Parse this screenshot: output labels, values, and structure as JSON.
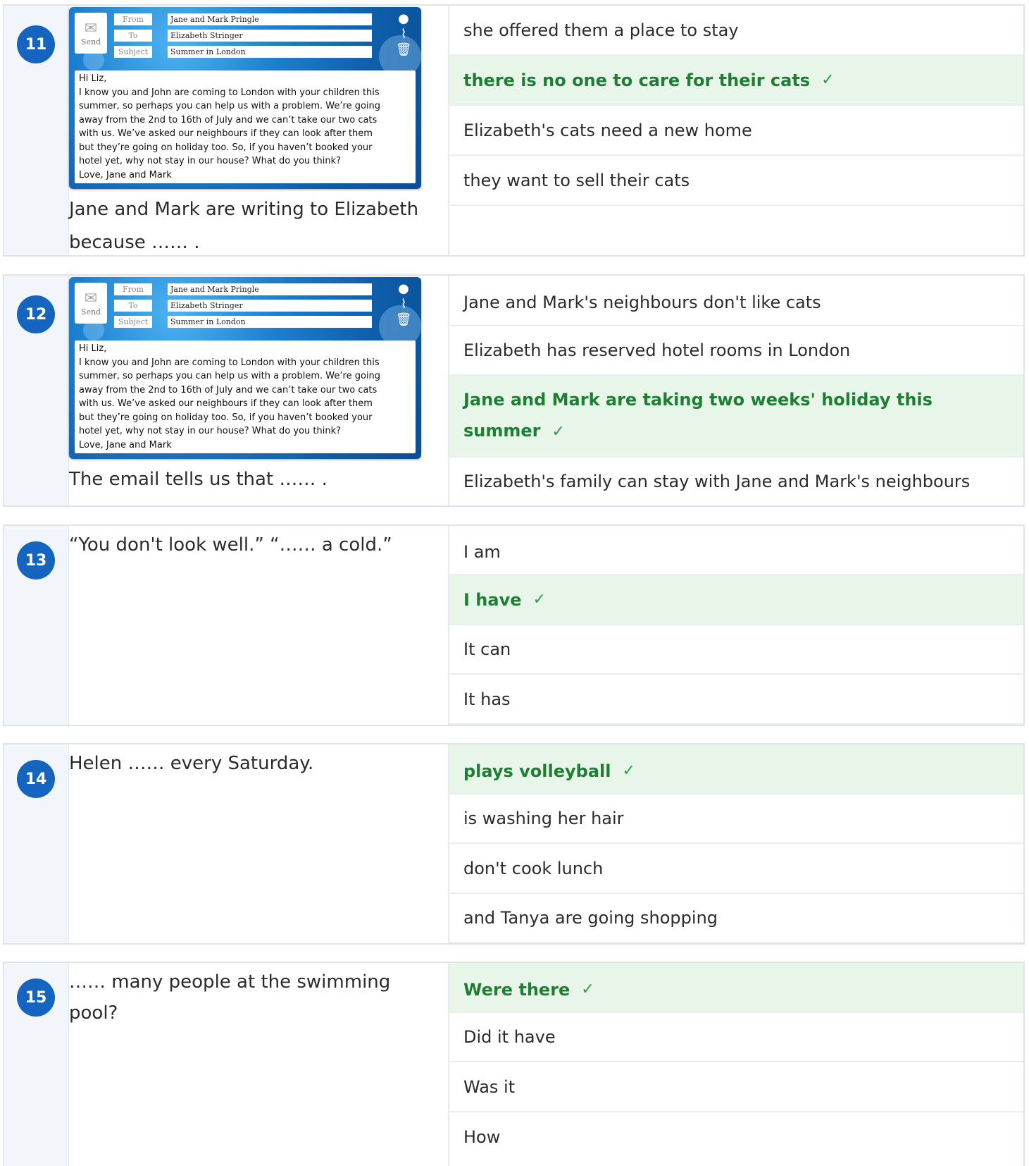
{
  "email": {
    "send_label": "Send",
    "from_label": "From",
    "to_label": "To",
    "subject_label": "Subject",
    "from": "Jane and Mark Pringle",
    "to": "Elizabeth Stringer",
    "subject": "Summer in London",
    "lines": [
      "Hi Liz,",
      "I know you and John are coming to London with your children this",
      "summer, so perhaps you can help us with a problem. We’re going",
      "away from the 2nd to 16th of July and we can’t take our two cats",
      "with us. We’ve asked our neighbours if they can look after them",
      "but they’re going on holiday too. So, if you haven’t booked your",
      "hotel yet, why not stay in our house? What do you think?",
      "Love, Jane and Mark"
    ]
  },
  "check_mark": "✓",
  "questions": [
    {
      "number": "11",
      "text": "Jane and Mark are writing to Elizabeth because …… .",
      "options": [
        {
          "text": "she offered them a place to stay",
          "correct": false
        },
        {
          "text": "there is no one to care for their cats",
          "correct": true
        },
        {
          "text": "Elizabeth's cats need a new home",
          "correct": false
        },
        {
          "text": "they want to sell their cats",
          "correct": false
        }
      ]
    },
    {
      "number": "12",
      "text": "The email tells us that …… .",
      "options": [
        {
          "text": "Jane and Mark's neighbours don't like cats",
          "correct": false
        },
        {
          "text": "Elizabeth has reserved hotel rooms in London",
          "correct": false
        },
        {
          "text": "Jane and Mark are taking two weeks' holiday this summer",
          "correct": true
        },
        {
          "text": "Elizabeth's family can stay with Jane and Mark's neighbours",
          "correct": false
        }
      ]
    },
    {
      "number": "13",
      "text": "“You don't look well.” “…… a cold.”",
      "options": [
        {
          "text": "I am",
          "correct": false
        },
        {
          "text": "I have",
          "correct": true
        },
        {
          "text": "It can",
          "correct": false
        },
        {
          "text": "It has",
          "correct": false
        }
      ]
    },
    {
      "number": "14",
      "text": "Helen …… every Saturday.",
      "options": [
        {
          "text": "plays volleyball",
          "correct": true
        },
        {
          "text": "is washing her hair",
          "correct": false
        },
        {
          "text": "don't cook lunch",
          "correct": false
        },
        {
          "text": "and Tanya are going shopping",
          "correct": false
        }
      ]
    },
    {
      "number": "15",
      "text": "…… many people at the swimming pool?",
      "options": [
        {
          "text": "Were there",
          "correct": true
        },
        {
          "text": "Did it have",
          "correct": false
        },
        {
          "text": "Was it",
          "correct": false
        },
        {
          "text": "How",
          "correct": false
        }
      ]
    }
  ]
}
